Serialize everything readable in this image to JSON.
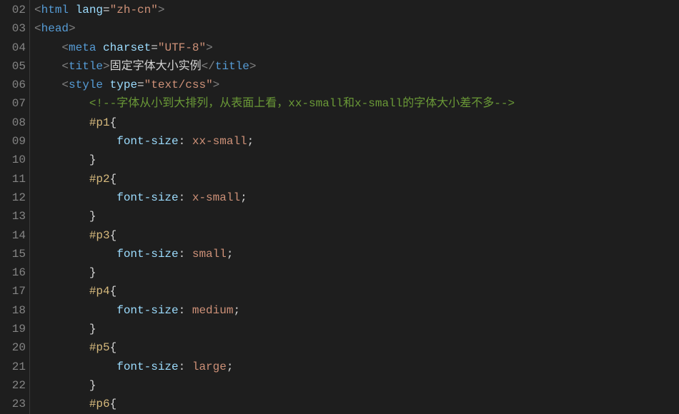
{
  "lines": [
    {
      "num": "02",
      "indent": "",
      "parts": [
        {
          "t": "<",
          "c": "tag-bracket"
        },
        {
          "t": "html",
          "c": "tag-name"
        },
        {
          "t": " ",
          "c": ""
        },
        {
          "t": "lang",
          "c": "attr-name"
        },
        {
          "t": "=",
          "c": "attr-equals"
        },
        {
          "t": "\"zh-cn\"",
          "c": "attr-value"
        },
        {
          "t": ">",
          "c": "tag-bracket"
        }
      ]
    },
    {
      "num": "03",
      "indent": "",
      "parts": [
        {
          "t": "<",
          "c": "tag-bracket"
        },
        {
          "t": "head",
          "c": "tag-name"
        },
        {
          "t": ">",
          "c": "tag-bracket"
        }
      ]
    },
    {
      "num": "04",
      "indent": "    ",
      "parts": [
        {
          "t": "<",
          "c": "tag-bracket"
        },
        {
          "t": "meta",
          "c": "tag-name"
        },
        {
          "t": " ",
          "c": ""
        },
        {
          "t": "charset",
          "c": "attr-name"
        },
        {
          "t": "=",
          "c": "attr-equals"
        },
        {
          "t": "\"UTF-8\"",
          "c": "attr-value"
        },
        {
          "t": ">",
          "c": "tag-bracket"
        }
      ]
    },
    {
      "num": "05",
      "indent": "    ",
      "parts": [
        {
          "t": "<",
          "c": "tag-bracket"
        },
        {
          "t": "title",
          "c": "tag-name"
        },
        {
          "t": ">",
          "c": "tag-bracket"
        },
        {
          "t": "固定字体大小实例",
          "c": "title-text"
        },
        {
          "t": "</",
          "c": "tag-bracket"
        },
        {
          "t": "title",
          "c": "tag-name"
        },
        {
          "t": ">",
          "c": "tag-bracket"
        }
      ]
    },
    {
      "num": "06",
      "indent": "    ",
      "parts": [
        {
          "t": "<",
          "c": "tag-bracket"
        },
        {
          "t": "style",
          "c": "tag-name"
        },
        {
          "t": " ",
          "c": ""
        },
        {
          "t": "type",
          "c": "attr-name"
        },
        {
          "t": "=",
          "c": "attr-equals"
        },
        {
          "t": "\"text/css\"",
          "c": "attr-value"
        },
        {
          "t": ">",
          "c": "tag-bracket"
        }
      ]
    },
    {
      "num": "07",
      "indent": "        ",
      "parts": [
        {
          "t": "<!--字体从小到大排列，从表面上看，xx-small和x-small的字体大小差不多-->",
          "c": "comment"
        }
      ]
    },
    {
      "num": "08",
      "indent": "        ",
      "parts": [
        {
          "t": "#p1",
          "c": "css-selector"
        },
        {
          "t": "{",
          "c": "css-punct"
        }
      ]
    },
    {
      "num": "09",
      "indent": "            ",
      "parts": [
        {
          "t": "font-size",
          "c": "css-prop"
        },
        {
          "t": ": ",
          "c": "css-punct"
        },
        {
          "t": "xx-small",
          "c": "css-value"
        },
        {
          "t": ";",
          "c": "css-punct"
        }
      ]
    },
    {
      "num": "10",
      "indent": "        ",
      "parts": [
        {
          "t": "}",
          "c": "css-punct"
        }
      ]
    },
    {
      "num": "11",
      "indent": "        ",
      "parts": [
        {
          "t": "#p2",
          "c": "css-selector"
        },
        {
          "t": "{",
          "c": "css-punct"
        }
      ]
    },
    {
      "num": "12",
      "indent": "            ",
      "parts": [
        {
          "t": "font-size",
          "c": "css-prop"
        },
        {
          "t": ": ",
          "c": "css-punct"
        },
        {
          "t": "x-small",
          "c": "css-value"
        },
        {
          "t": ";",
          "c": "css-punct"
        }
      ]
    },
    {
      "num": "13",
      "indent": "        ",
      "parts": [
        {
          "t": "}",
          "c": "css-punct"
        }
      ]
    },
    {
      "num": "14",
      "indent": "        ",
      "parts": [
        {
          "t": "#p3",
          "c": "css-selector"
        },
        {
          "t": "{",
          "c": "css-punct"
        }
      ]
    },
    {
      "num": "15",
      "indent": "            ",
      "parts": [
        {
          "t": "font-size",
          "c": "css-prop"
        },
        {
          "t": ": ",
          "c": "css-punct"
        },
        {
          "t": "small",
          "c": "css-value"
        },
        {
          "t": ";",
          "c": "css-punct"
        }
      ]
    },
    {
      "num": "16",
      "indent": "        ",
      "parts": [
        {
          "t": "}",
          "c": "css-punct"
        }
      ]
    },
    {
      "num": "17",
      "indent": "        ",
      "parts": [
        {
          "t": "#p4",
          "c": "css-selector"
        },
        {
          "t": "{",
          "c": "css-punct"
        }
      ]
    },
    {
      "num": "18",
      "indent": "            ",
      "parts": [
        {
          "t": "font-size",
          "c": "css-prop"
        },
        {
          "t": ": ",
          "c": "css-punct"
        },
        {
          "t": "medium",
          "c": "css-value"
        },
        {
          "t": ";",
          "c": "css-punct"
        }
      ]
    },
    {
      "num": "19",
      "indent": "        ",
      "parts": [
        {
          "t": "}",
          "c": "css-punct"
        }
      ]
    },
    {
      "num": "20",
      "indent": "        ",
      "parts": [
        {
          "t": "#p5",
          "c": "css-selector"
        },
        {
          "t": "{",
          "c": "css-punct"
        }
      ]
    },
    {
      "num": "21",
      "indent": "            ",
      "parts": [
        {
          "t": "font-size",
          "c": "css-prop"
        },
        {
          "t": ": ",
          "c": "css-punct"
        },
        {
          "t": "large",
          "c": "css-value"
        },
        {
          "t": ";",
          "c": "css-punct"
        }
      ]
    },
    {
      "num": "22",
      "indent": "        ",
      "parts": [
        {
          "t": "}",
          "c": "css-punct"
        }
      ]
    },
    {
      "num": "23",
      "indent": "        ",
      "parts": [
        {
          "t": "#p6",
          "c": "css-selector"
        },
        {
          "t": "{",
          "c": "css-punct"
        }
      ]
    }
  ]
}
